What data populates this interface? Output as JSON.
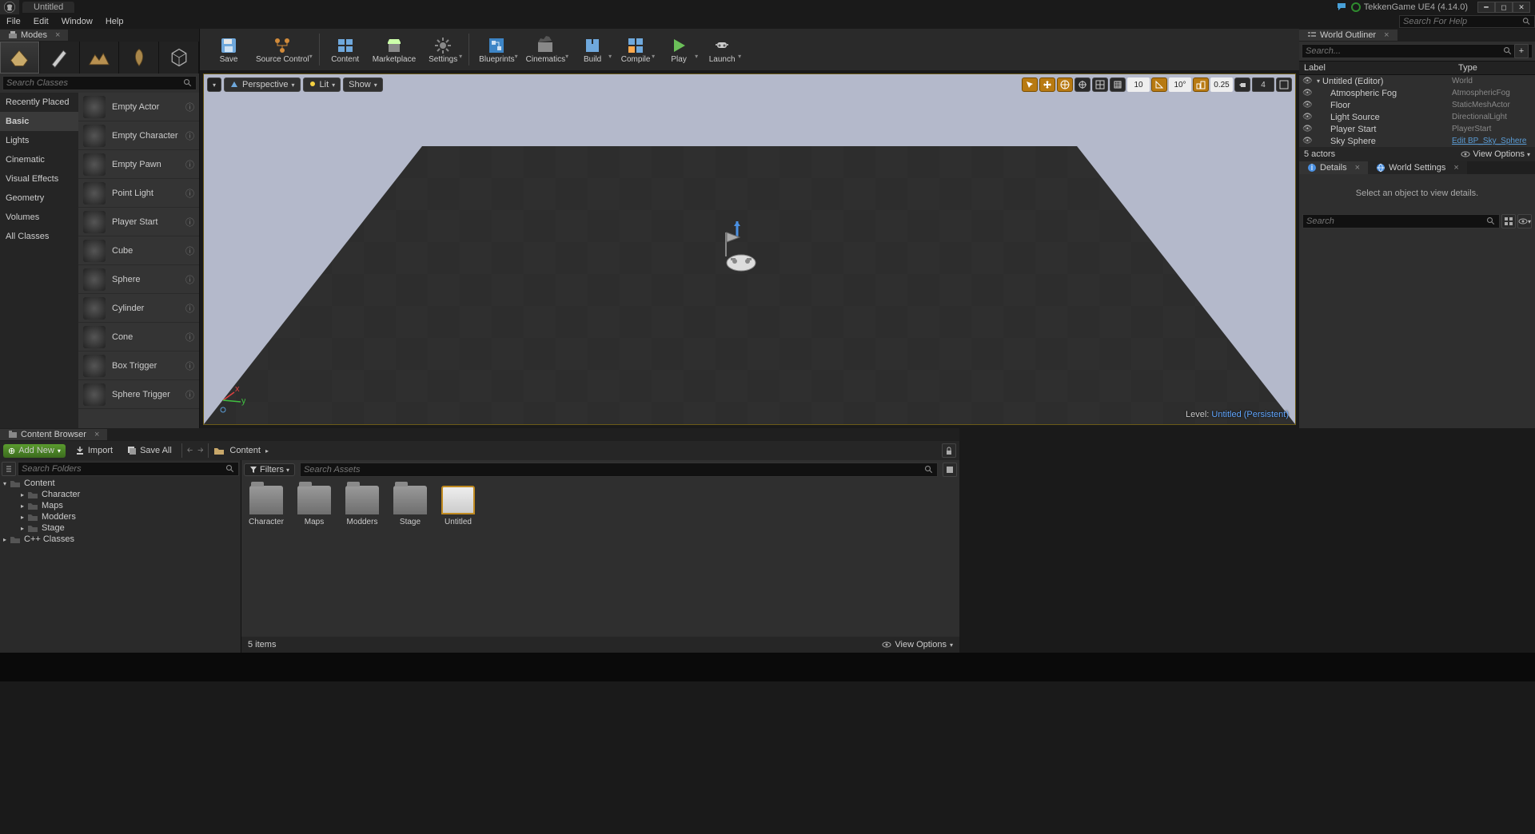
{
  "title_tab": "Untitled",
  "project_name": "TekkenGame UE4 (4.14.0)",
  "help_search_placeholder": "Search For Help",
  "menus": {
    "file": "File",
    "edit": "Edit",
    "window": "Window",
    "help": "Help"
  },
  "modes": {
    "title": "Modes",
    "search_placeholder": "Search Classes",
    "categories": [
      "Recently Placed",
      "Basic",
      "Lights",
      "Cinematic",
      "Visual Effects",
      "Geometry",
      "Volumes",
      "All Classes"
    ],
    "active_category": "Basic",
    "items": [
      "Empty Actor",
      "Empty Character",
      "Empty Pawn",
      "Point Light",
      "Player Start",
      "Cube",
      "Sphere",
      "Cylinder",
      "Cone",
      "Box Trigger",
      "Sphere Trigger"
    ]
  },
  "toolbar": {
    "save": "Save",
    "source_control": "Source Control",
    "content": "Content",
    "marketplace": "Marketplace",
    "settings": "Settings",
    "blueprints": "Blueprints",
    "cinematics": "Cinematics",
    "build": "Build",
    "compile": "Compile",
    "play": "Play",
    "launch": "Launch"
  },
  "viewport": {
    "perspective": "Perspective",
    "lit": "Lit",
    "show": "Show",
    "grid_snap": "10",
    "angle_snap": "10°",
    "scale_snap": "0.25",
    "cam_speed": "4",
    "level_prefix": "Level:",
    "level_name": "Untitled (Persistent)"
  },
  "outliner": {
    "title": "World Outliner",
    "search_placeholder": "Search...",
    "label_hdr": "Label",
    "type_hdr": "Type",
    "rows": [
      {
        "label": "Untitled (Editor)",
        "type": "World",
        "indent": 0,
        "expand": true
      },
      {
        "label": "Atmospheric Fog",
        "type": "AtmosphericFog",
        "indent": 1
      },
      {
        "label": "Floor",
        "type": "StaticMeshActor",
        "indent": 1
      },
      {
        "label": "Light Source",
        "type": "DirectionalLight",
        "indent": 1
      },
      {
        "label": "Player Start",
        "type": "PlayerStart",
        "indent": 1
      },
      {
        "label": "Sky Sphere",
        "type": "Edit BP_Sky_Sphere",
        "indent": 1,
        "link": true
      }
    ],
    "footer_count": "5 actors",
    "view_options": "View Options"
  },
  "details": {
    "tab1": "Details",
    "tab2": "World Settings",
    "empty_msg": "Select an object to view details.",
    "search_placeholder": "Search"
  },
  "cb": {
    "title": "Content Browser",
    "add_new": "Add New",
    "import": "Import",
    "save_all": "Save All",
    "path": "Content",
    "tree_search_placeholder": "Search Folders",
    "tree": {
      "content": "Content",
      "children": [
        "Character",
        "Maps",
        "Modders",
        "Stage"
      ],
      "cpp": "C++ Classes"
    },
    "filters": "Filters",
    "asset_search_placeholder": "Search Assets",
    "assets": [
      {
        "name": "Character",
        "kind": "folder"
      },
      {
        "name": "Maps",
        "kind": "folder"
      },
      {
        "name": "Modders",
        "kind": "folder"
      },
      {
        "name": "Stage",
        "kind": "folder"
      },
      {
        "name": "Untitled",
        "kind": "map"
      }
    ],
    "footer_count": "5 items",
    "view_options": "View Options"
  }
}
